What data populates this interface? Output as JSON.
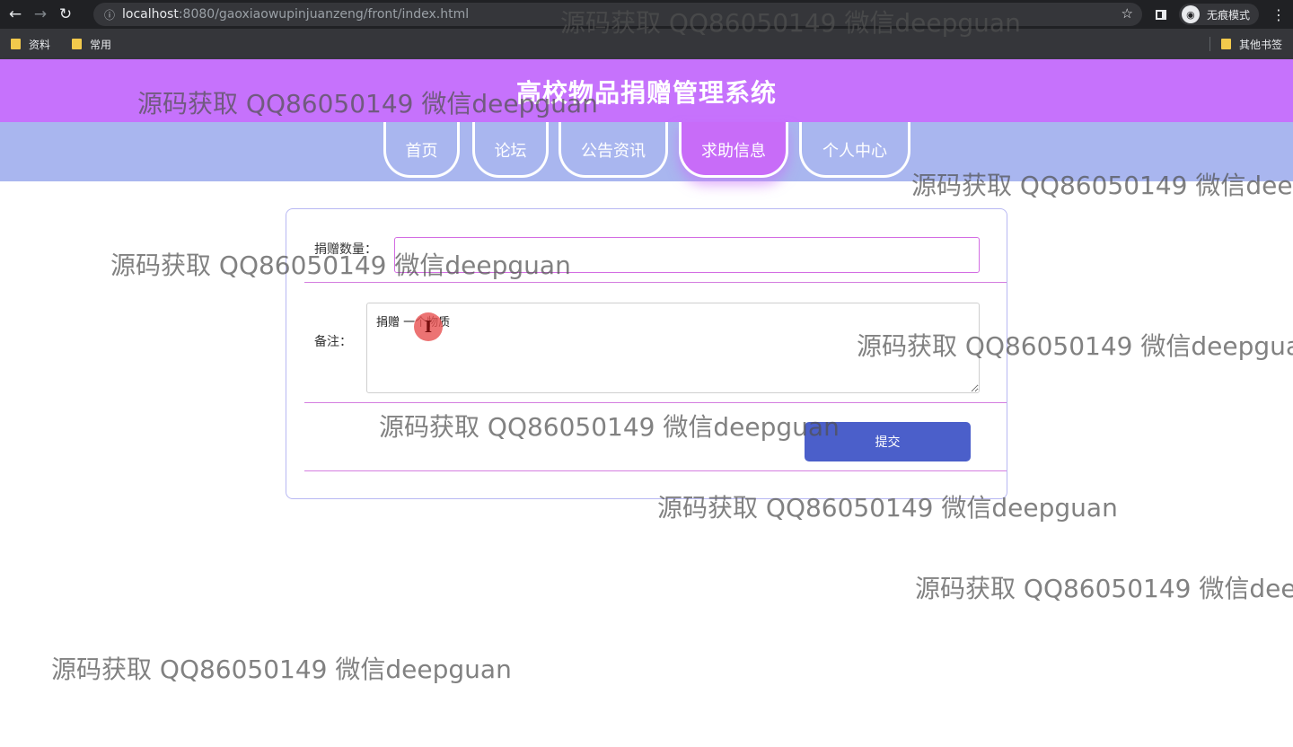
{
  "browser": {
    "back_icon": "←",
    "forward_icon": "→",
    "reload_icon": "↻",
    "info_icon": "ⓘ",
    "url_host": "localhost",
    "url_rest": ":8080/gaoxiaowupinjuanzeng/front/index.html",
    "star_icon": "☆",
    "incognito_label": "无痕模式",
    "incognito_icon": "◉",
    "menu_icon": "⋮",
    "bookmarks": [
      "资料",
      "常用"
    ],
    "other_bookmarks": "其他书签"
  },
  "site": {
    "title": "高校物品捐赠管理系统",
    "nav": [
      {
        "label": "首页"
      },
      {
        "label": "论坛"
      },
      {
        "label": "公告资讯"
      },
      {
        "label": "求助信息",
        "active": true
      },
      {
        "label": "个人中心"
      }
    ]
  },
  "form": {
    "quantity_label": "捐赠数量：",
    "quantity_value": "",
    "note_label": "备注：",
    "note_value": "捐赠 一个物质",
    "submit_label": "提交"
  },
  "cursor_glyph": "I",
  "watermark_text": "源码获取 QQ86050149 微信deepguan",
  "colors": {
    "header": "#c672fc",
    "nav_bar": "#a9b6ef",
    "active_tab": "#c86cf8",
    "submit": "#4b5fca"
  }
}
